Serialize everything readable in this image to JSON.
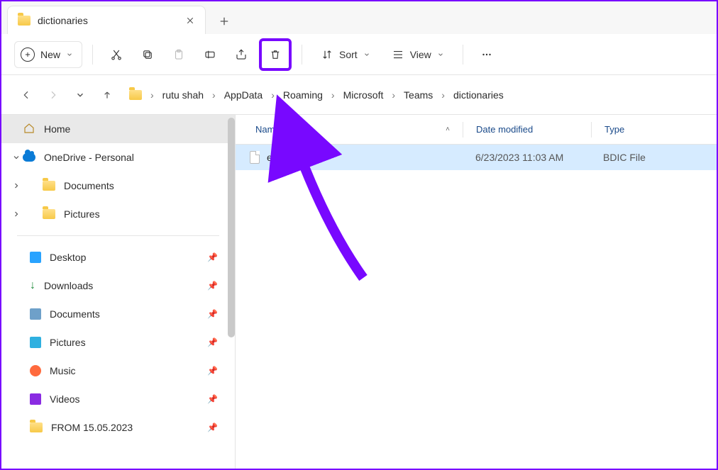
{
  "tab": {
    "title": "dictionaries"
  },
  "toolbar": {
    "new_label": "New",
    "sort_label": "Sort",
    "view_label": "View"
  },
  "breadcrumbs": [
    "rutu shah",
    "AppData",
    "Roaming",
    "Microsoft",
    "Teams",
    "dictionaries"
  ],
  "columns": {
    "name": "Name",
    "date": "Date modified",
    "type": "Type"
  },
  "rows": [
    {
      "name": "en-US.bdic",
      "date": "6/23/2023 11:03 AM",
      "type": "BDIC File"
    }
  ],
  "sidebar": {
    "home": "Home",
    "onedrive": "OneDrive - Personal",
    "onedrive_children": [
      "Documents",
      "Pictures"
    ],
    "pinned": [
      "Desktop",
      "Downloads",
      "Documents",
      "Pictures",
      "Music",
      "Videos",
      "FROM 15.05.2023"
    ]
  },
  "colors": {
    "accent": "#7808ff"
  }
}
